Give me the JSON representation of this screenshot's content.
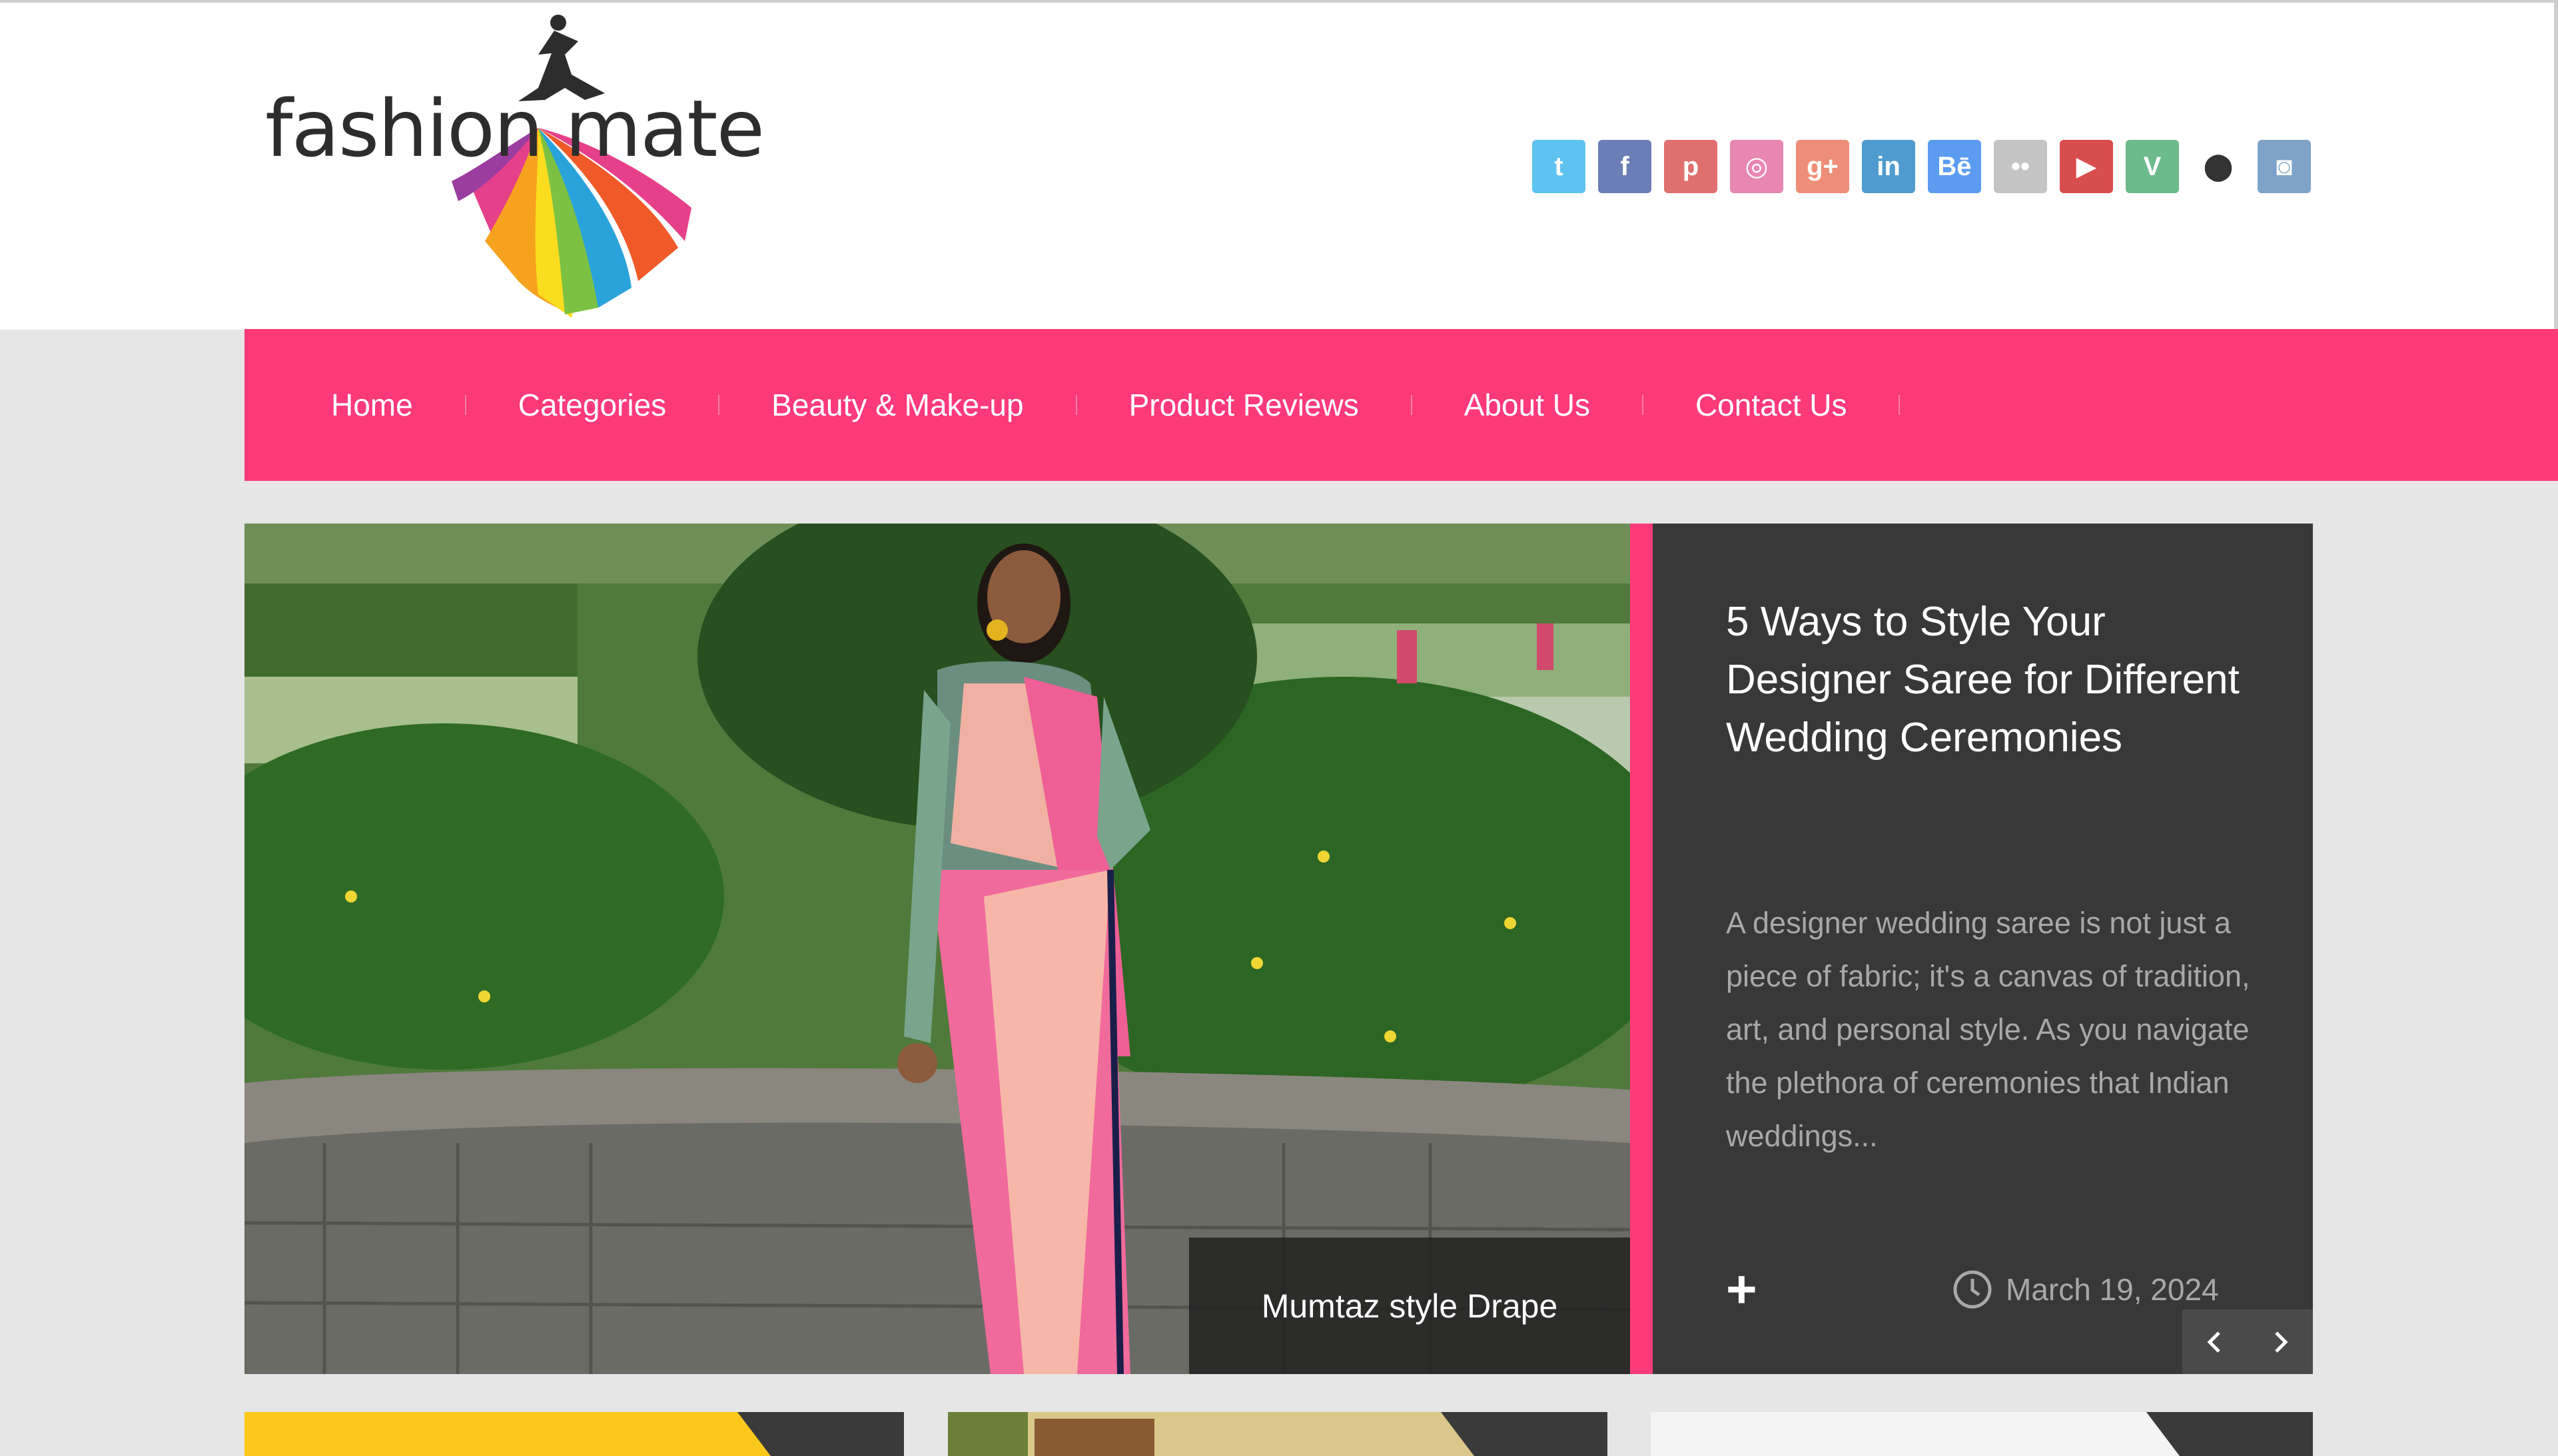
{
  "logo": {
    "text_left": "fashion",
    "text_right": "mate"
  },
  "social": [
    {
      "icon": "twitter-icon",
      "glyph": "t",
      "color": "#5ec3f0"
    },
    {
      "icon": "facebook-icon",
      "glyph": "f",
      "color": "#6b7fb6"
    },
    {
      "icon": "pinterest-icon",
      "glyph": "p",
      "color": "#e07070"
    },
    {
      "icon": "dribbble-icon",
      "glyph": "◎",
      "color": "#e887b2"
    },
    {
      "icon": "google-plus-icon",
      "glyph": "g+",
      "color": "#ee8e78"
    },
    {
      "icon": "linkedin-icon",
      "glyph": "in",
      "color": "#4f9bcf"
    },
    {
      "icon": "behance-icon",
      "glyph": "Bē",
      "color": "#5b9cf1"
    },
    {
      "icon": "flickr-icon",
      "glyph": "••",
      "color": "#c4c4c4"
    },
    {
      "icon": "youtube-icon",
      "glyph": "▶",
      "color": "#d84d4d"
    },
    {
      "icon": "vine-icon",
      "glyph": "V",
      "color": "#6dba8a"
    },
    {
      "icon": "location-pin-icon",
      "glyph": "⬤",
      "color": "#ffffff"
    },
    {
      "icon": "instagram-icon",
      "glyph": "◙",
      "color": "#7fa3c8"
    }
  ],
  "nav": [
    {
      "label": "Home"
    },
    {
      "label": "Categories"
    },
    {
      "label": "Beauty & Make-up"
    },
    {
      "label": "Product Reviews"
    },
    {
      "label": "About Us"
    },
    {
      "label": "Contact Us"
    }
  ],
  "slider": {
    "caption": "Mumtaz style Drape",
    "title": "5 Ways to Style Your Designer Saree for Different Wedding Ceremonies",
    "excerpt": "A designer wedding saree is not just a piece of fabric; it's a canvas of tradition, art, and personal style. As you navigate the plethora of ceremonies that Indian weddings...",
    "plus": "+",
    "date": "March 19, 2024"
  },
  "colors": {
    "brand_pink": "#fc3a7a",
    "panel_dark": "#383838",
    "page_bg": "#e6e6e6"
  }
}
